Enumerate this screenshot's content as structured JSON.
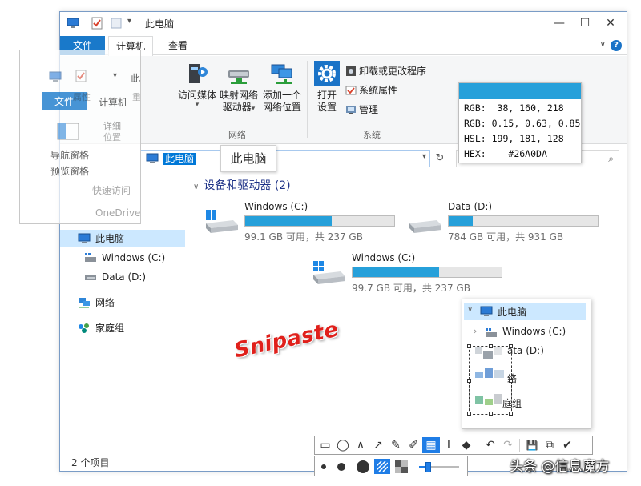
{
  "window": {
    "title": "此电脑",
    "controls": {
      "minimize": "—",
      "maximize": "☐",
      "close": "✕"
    }
  },
  "tabs": {
    "file": "文件",
    "computer": "计算机",
    "view": "查看",
    "help": "?"
  },
  "ribbon": {
    "media_access": "访问媒体",
    "map_drive_line1": "映射网络",
    "map_drive_line2": "驱动器",
    "add_location_line1": "添加一个",
    "add_location_line2": "网络位置",
    "group_network": "网络",
    "open_settings_line1": "打开",
    "open_settings_line2": "设置",
    "uninstall": "卸载或更改程序",
    "sys_props": "系统属性",
    "manage": "管理",
    "group_system": "系统"
  },
  "address": {
    "path": "此电脑",
    "tooltip": "此电脑",
    "refresh": "↻",
    "dropdown": "▾",
    "search_icon": "⌕"
  },
  "nav": {
    "this_pc": "此电脑",
    "windows_c": "Windows (C:)",
    "data_d": "Data (D:)",
    "network": "网络",
    "homegroup": "家庭组"
  },
  "content": {
    "group_header": "设备和驱动器 (2)",
    "drives": [
      {
        "name": "Windows (C:)",
        "size_text": "99.1 GB 可用，共 237 GB",
        "used_fraction": 0.58
      },
      {
        "name": "Data (D:)",
        "size_text": "784 GB 可用，共 931 GB",
        "used_fraction": 0.16
      },
      {
        "name": "Windows (C:)",
        "size_text": "99.7 GB 可用，共 237 GB",
        "used_fraction": 0.58
      }
    ]
  },
  "status": {
    "item_count": "2 个项目"
  },
  "ghost": {
    "title": "此",
    "tab_file": "文件",
    "tab_computer": "计算机",
    "frag_props": "属性",
    "frag_rename": "重命名",
    "frag_details": "详细",
    "frag_position": "位置",
    "nav_pane": "导航窗格",
    "preview_pane": "预览窗格",
    "quick_access": "快速访问",
    "onedrive": "OneDrive"
  },
  "color_info": {
    "swatch": "#26A0DA",
    "rgb_label": "RGB:",
    "rgb_int": "  38, 160, 218",
    "rgbf_label": "RGB:",
    "rgb_float": " 0.15, 0.63, 0.85",
    "hsl_label": "HSL:",
    "hsl": " 199, 181, 128",
    "hex_label": "HEX:",
    "hex": "    #26A0DA"
  },
  "tree_snip": {
    "this_pc": "此电脑",
    "windows_c": "Windows (C:)",
    "frag_data": "ata (D:)",
    "frag_network": "络",
    "frag_homegroup": "庭组"
  },
  "watermark": "Snipaste",
  "credit": "头条 @信息魔方",
  "toolbar_icons": [
    "▭",
    "◯",
    "∧",
    "↗",
    "✎",
    "✐",
    "▦",
    "I",
    "◆",
    "↶",
    "↷",
    "💾",
    "⧉",
    "✔"
  ]
}
